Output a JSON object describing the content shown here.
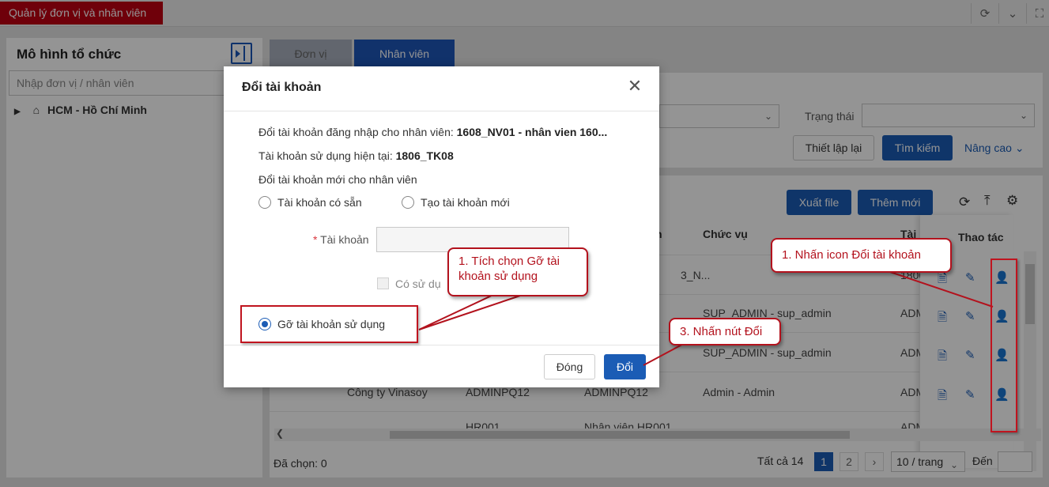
{
  "app": {
    "tab_title": "Quản lý đơn vị và nhân viên"
  },
  "left_panel": {
    "title": "Mô hình tổ chức",
    "search_placeholder": "Nhập đơn vị / nhân viên",
    "tree_root": "HCM - Hồ Chí Minh"
  },
  "tabs": [
    {
      "label": "Đơn vị",
      "active": false
    },
    {
      "label": "Nhân viên",
      "active": true
    }
  ],
  "filters": {
    "status_label": "Trạng thái",
    "reset_button": "Thiết lập lại",
    "search_button": "Tìm kiếm",
    "advanced_link": "Nâng cao"
  },
  "toolbar": {
    "export_button": "Xuất file",
    "add_button": "Thêm mới"
  },
  "table": {
    "headers": {
      "col_a": "n",
      "position": "Chức vụ",
      "col_b": "Tài k",
      "actions": "Thao tác"
    },
    "rows": [
      {
        "col1": "",
        "col2": "",
        "col3": "3_N...",
        "position": "",
        "col5": "1806"
      },
      {
        "col1": "",
        "col2": "",
        "col3": "",
        "position": "SUP_ADMIN - sup_admin",
        "col5": "ADM"
      },
      {
        "col1": "",
        "col2": "",
        "col3": "",
        "position": "SUP_ADMIN - sup_admin",
        "col5": "ADM"
      },
      {
        "col1": "Công ty Vinasoy",
        "col2": "ADMINPQ12",
        "col3": "ADMINPQ12",
        "position": "Admin - Admin",
        "col5": "ADM"
      },
      {
        "col1": "",
        "col2": "HR001",
        "col3": "Nhân viên HR001",
        "position": "",
        "col5": "ADM"
      }
    ]
  },
  "footer": {
    "selected": "Đã chọn: 0",
    "total": "Tất cả 14",
    "pages": [
      "1",
      "2"
    ],
    "page_size": "10 / trang",
    "goto": "Đến"
  },
  "modal": {
    "title": "Đổi tài khoản",
    "line_employee_prefix": "Đổi tài khoản đăng nhập cho nhân viên: ",
    "line_employee_value": "1608_NV01 - nhân vien 160...",
    "line_current_prefix": "Tài khoản sử dụng hiện tại: ",
    "line_current_value": "1806_TK08",
    "line_new": "Đổi tài khoản mới cho nhân viên",
    "radio_existing": "Tài khoản có sẵn",
    "radio_create": "Tạo tài khoản mới",
    "account_label": "Tài khoản",
    "account_required_mark": "*",
    "account_value": "",
    "checkbox_label": "Có sử dụ",
    "radio_remove": "Gỡ tài khoản sử dụng",
    "close_button": "Đóng",
    "change_button": "Đổi"
  },
  "annotations": {
    "step1": "1. Nhấn icon Đổi tài khoản",
    "step2": "1. Tích chọn Gỡ tài khoản sử dụng",
    "step3": "3. Nhấn nút Đổi"
  },
  "colors": {
    "primary": "#1b5cb5",
    "brand_red": "#c00012",
    "annotation_red": "#b3121d"
  }
}
